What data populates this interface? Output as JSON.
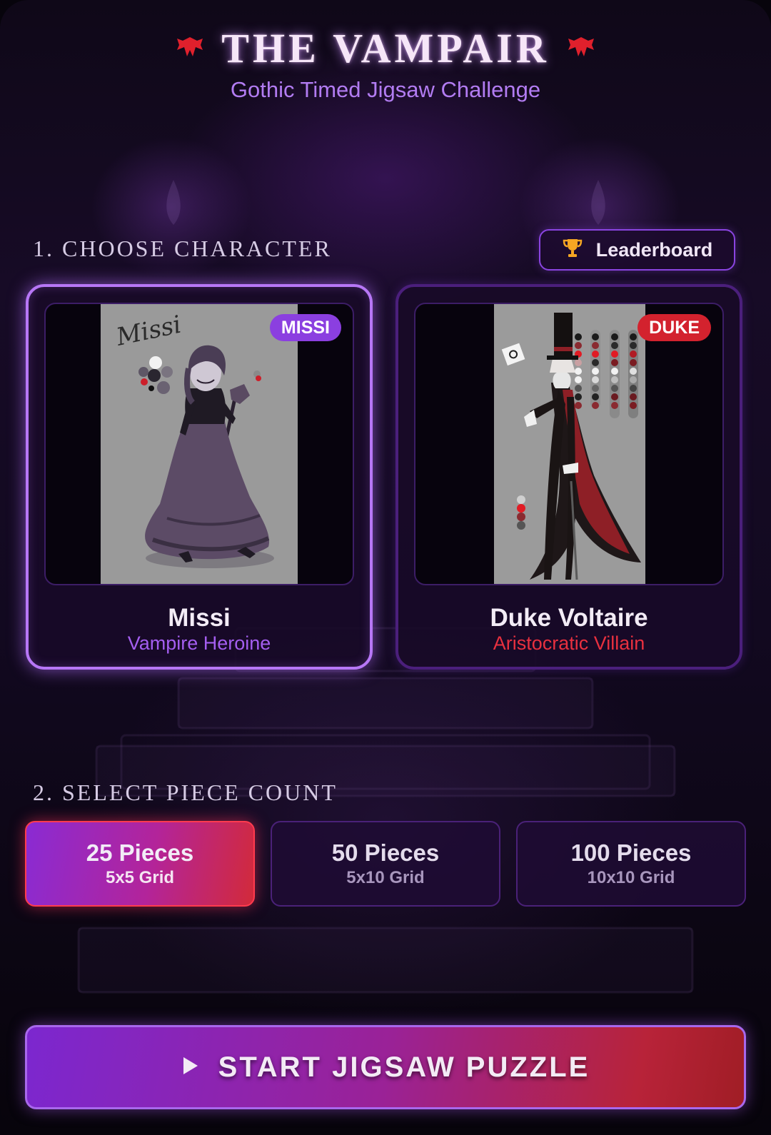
{
  "header": {
    "title": "THE VAMPAIR",
    "subtitle": "Gothic Timed Jigsaw Challenge",
    "ornament_icon": "bat-icon",
    "accent_color": "#e0202c"
  },
  "character_section": {
    "label": "1. CHOOSE CHARACTER",
    "leaderboard_label": "Leaderboard",
    "leaderboard_icon": "trophy-icon",
    "characters": [
      {
        "badge": "MISSI",
        "portrait_handwriting": "Missi",
        "name": "Missi",
        "role": "Vampire Heroine",
        "selected": true,
        "badge_color": "#8b3fe0",
        "role_color": "#a45ef0"
      },
      {
        "badge": "DUKE",
        "name": "Duke Voltaire",
        "role": "Aristocratic Villain",
        "selected": false,
        "badge_color": "#d3222e",
        "role_color": "#e8303f"
      }
    ]
  },
  "piece_section": {
    "label": "2. SELECT PIECE COUNT",
    "options": [
      {
        "label": "25 Pieces",
        "grid": "5x5 Grid",
        "selected": true
      },
      {
        "label": "50 Pieces",
        "grid": "5x10 Grid",
        "selected": false
      },
      {
        "label": "100 Pieces",
        "grid": "10x10 Grid",
        "selected": false
      }
    ]
  },
  "start_button": {
    "label": "START JIGSAW PUZZLE",
    "icon": "play-icon"
  }
}
